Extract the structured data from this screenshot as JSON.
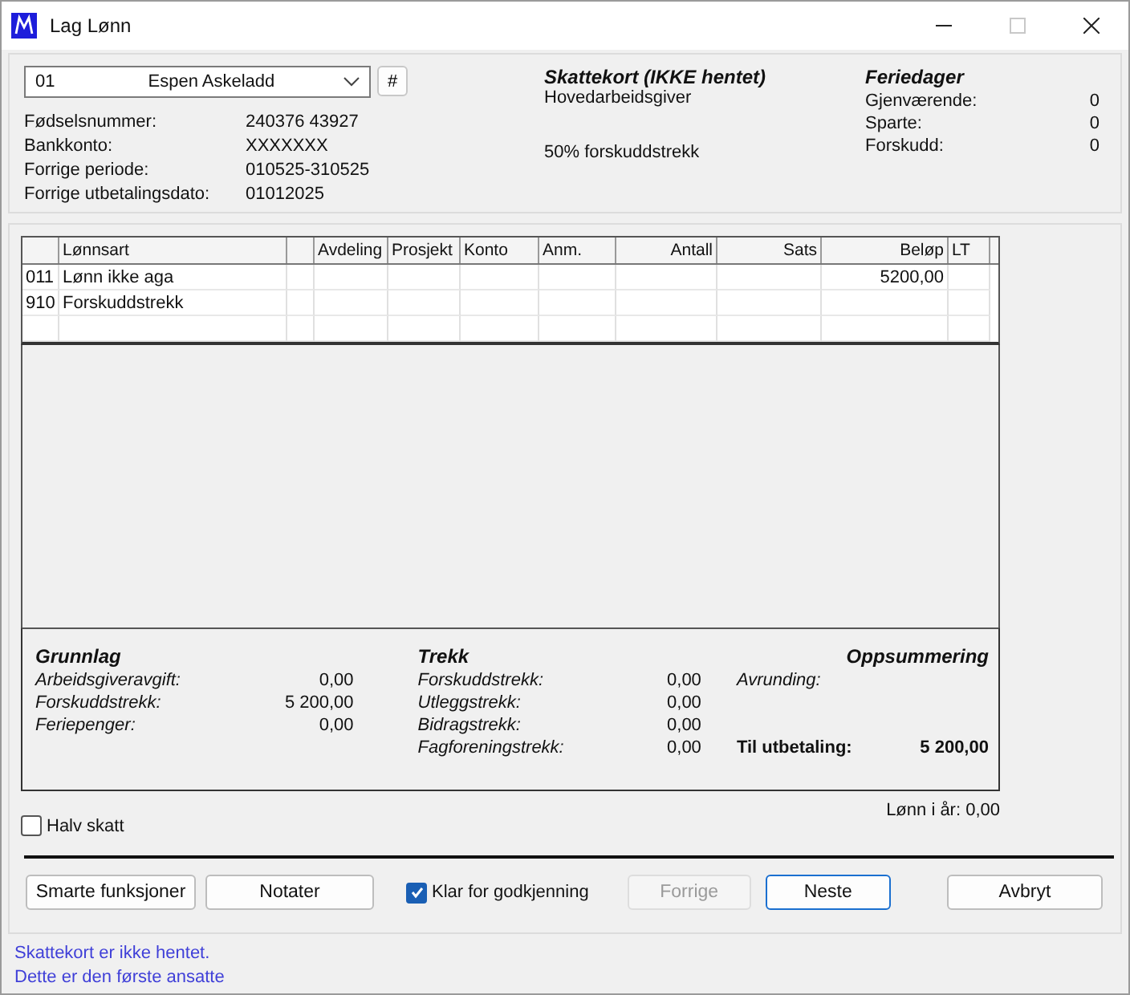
{
  "window": {
    "title": "Lag Lønn",
    "maximize_disabled": true
  },
  "employee": {
    "number": "01",
    "name": "Espen Askeladd",
    "hash_button": "#"
  },
  "info": [
    {
      "label": "Fødselsnummer:",
      "value": "240376 43927"
    },
    {
      "label": "Bankkonto:",
      "value": "XXXXXXX"
    },
    {
      "label": "Forrige periode:",
      "value": "010525-310525"
    },
    {
      "label": "Forrige utbetalingsdato:",
      "value": "01012025"
    }
  ],
  "tax_card": {
    "title": "Skattekort (IKKE hentet)",
    "employer": "Hovedarbeidsgiver",
    "deduction": "50% forskuddstrekk"
  },
  "holidays": {
    "title": "Feriedager",
    "rows": [
      {
        "label": "Gjenværende:",
        "value": "0"
      },
      {
        "label": "Sparte:",
        "value": "0"
      },
      {
        "label": "Forskudd:",
        "value": "0"
      }
    ]
  },
  "table": {
    "columns": [
      "Lønnsart",
      "Avdeling",
      "Prosjekt",
      "Konto",
      "Anm.",
      "Antall",
      "Sats",
      "Beløp",
      "LT"
    ],
    "rows": [
      {
        "code": "011",
        "type": "Lønn ikke aga",
        "amount": "5200,00"
      },
      {
        "code": "910",
        "type": "Forskuddstrekk"
      }
    ]
  },
  "summary": {
    "basis": {
      "title": "Grunnlag",
      "rows": [
        {
          "label": "Arbeidsgiveravgift:",
          "value": "0,00"
        },
        {
          "label": "Forskuddstrekk:",
          "value": "5 200,00"
        },
        {
          "label": "Feriepenger:",
          "value": "0,00"
        }
      ]
    },
    "deductions": {
      "title": "Trekk",
      "rows": [
        {
          "label": "Forskuddstrekk:",
          "value": "0,00"
        },
        {
          "label": "Utleggstrekk:",
          "value": "0,00"
        },
        {
          "label": "Bidragstrekk:",
          "value": "0,00"
        },
        {
          "label": "Fagforeningstrekk:",
          "value": "0,00"
        }
      ]
    },
    "totals": {
      "title": "Oppsummering",
      "rounding_label": "Avrunding:",
      "total_label": "Til utbetaling:",
      "total_value": "5 200,00"
    }
  },
  "salary_this_year": "Lønn i år: 0,00",
  "half_tax": {
    "label": "Halv skatt",
    "checked": false
  },
  "actions": [
    {
      "kind": "button",
      "label": "Smarte funksjoner",
      "disabled": false,
      "default": false
    },
    {
      "kind": "button",
      "label": "Notater",
      "disabled": false,
      "default": false
    },
    {
      "kind": "checkbox",
      "label": "Klar for godkjenning",
      "checked": true
    },
    {
      "kind": "button",
      "label": "Forrige",
      "disabled": true,
      "default": false
    },
    {
      "kind": "button",
      "label": "Neste",
      "disabled": false,
      "default": true
    },
    {
      "kind": "button",
      "label": "Avbryt",
      "disabled": false,
      "default": false
    }
  ],
  "status_messages": [
    "Skattekort er ikke hentet.",
    "Dette er den første ansatte"
  ]
}
